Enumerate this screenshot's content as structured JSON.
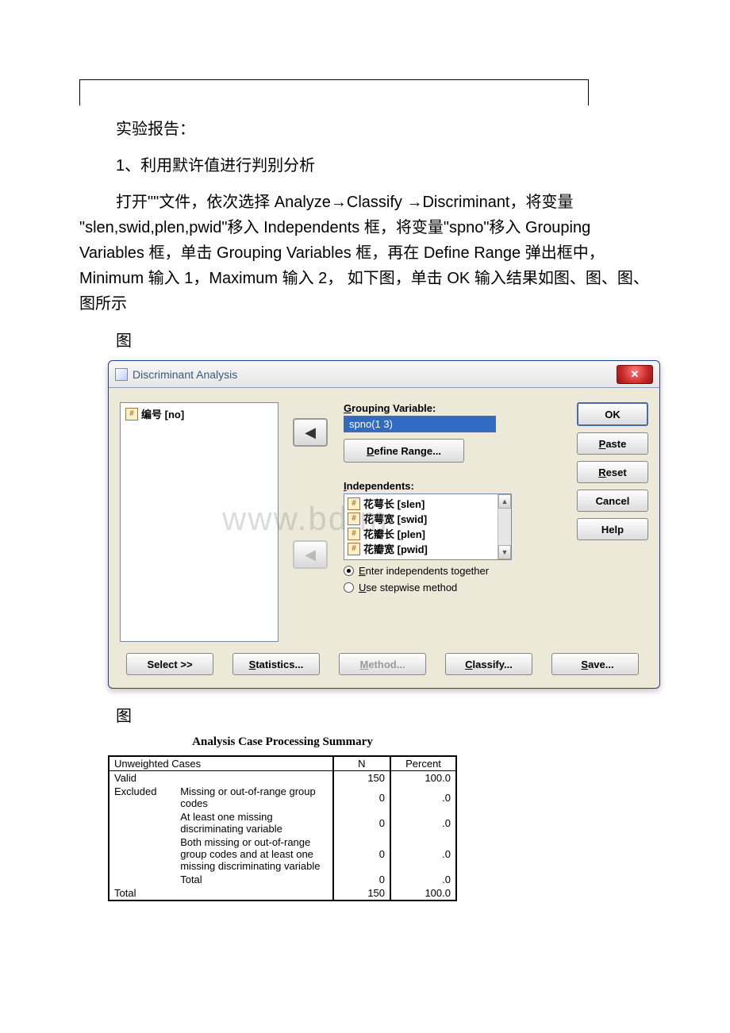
{
  "text": {
    "report_heading": "实验报告：",
    "step1": "1、利用默许值进行判别分析",
    "para1": "打开\"\"文件，依次选择 Analyze→Classify →Discriminant，将变量 \"slen,swid,plen,pwid\"移入 Independents 框，将变量\"spno\"移入 Grouping Variables 框，单击 Grouping Variables 框，再在 Define Range 弹出框中，Minimum 输入 1，Maximum 输入 2， 如下图，单击 OK 输入结果如图、图、图、图所示",
    "fig_a": "图",
    "fig_b": "图"
  },
  "dialog": {
    "title": "Discriminant Analysis",
    "close_x": "✕",
    "left_var": "编号 [no]",
    "grouping_lbl_pre": "G",
    "grouping_lbl": "rouping Variable:",
    "grouping_value": "spno(1 3)",
    "define_btn_pre": "D",
    "define_btn": "efine Range...",
    "indep_lbl_pre": "I",
    "indep_lbl": "ndependents:",
    "indep_items": [
      "花萼长 [slen]",
      "花萼宽 [swid]",
      "花瓣长 [plen]",
      "花瓣宽 [pwid]"
    ],
    "radio1_pre": "E",
    "radio1": "nter independents together",
    "radio2_pre": "U",
    "radio2": "se stepwise method",
    "right_buttons": {
      "ok": "OK",
      "paste_pre": "P",
      "paste": "aste",
      "reset_pre": "R",
      "reset": "eset",
      "cancel": "Cancel",
      "help": "Help"
    },
    "bottom_buttons": {
      "select": "Select >>",
      "stats_pre": "S",
      "stats": "tatistics...",
      "method_pre": "M",
      "method": "ethod...",
      "classify_pre": "C",
      "classify": "lassify...",
      "save_pre": "S",
      "save": "ave..."
    }
  },
  "watermark": "www.bd      m",
  "chart_data": {
    "type": "table",
    "title": "Analysis Case Processing Summary",
    "columns": [
      "Unweighted Cases",
      "",
      "N",
      "Percent"
    ],
    "rows": [
      {
        "c1": "Valid",
        "c2": "",
        "n": 150,
        "pct": "100.0"
      },
      {
        "c1": "Excluded",
        "c2": "Missing or out-of-range group codes",
        "n": 0,
        "pct": ".0"
      },
      {
        "c1": "",
        "c2": "At least one missing discriminating variable",
        "n": 0,
        "pct": ".0"
      },
      {
        "c1": "",
        "c2": "Both missing or out-of-range group codes and at least one missing discriminating variable",
        "n": 0,
        "pct": ".0"
      },
      {
        "c1": "",
        "c2": "Total",
        "n": 0,
        "pct": ".0"
      },
      {
        "c1": "Total",
        "c2": "",
        "n": 150,
        "pct": "100.0"
      }
    ]
  }
}
